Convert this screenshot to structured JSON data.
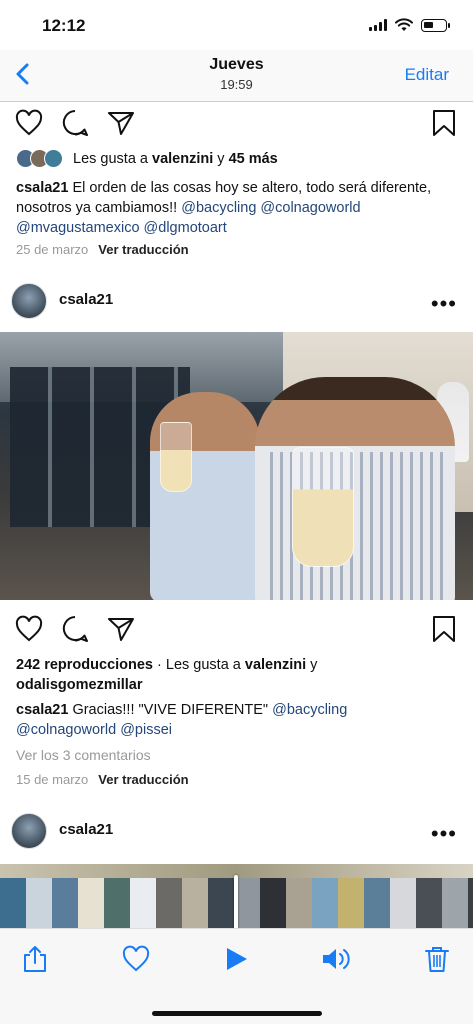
{
  "status_bar": {
    "time": "12:12"
  },
  "nav": {
    "title": "Jueves",
    "subtitle": "19:59",
    "edit_label": "Editar"
  },
  "post1": {
    "likes_prefix": "Les gusta a ",
    "likes_user": "valenzini",
    "likes_and": " y ",
    "likes_more": "45 más",
    "caption_user": "csala21",
    "caption_text": " El orden de las cosas hoy se altero, todo será diferente, nosotros ya cambiamos!! ",
    "mentions": [
      "@bacycling",
      "@colnagoworld",
      "@mvagustamexico",
      "@dlgmotoart"
    ],
    "date": "25 de marzo",
    "translate": "Ver traducción"
  },
  "post2": {
    "username": "csala21",
    "more": "•••",
    "views": "242 reproducciones",
    "likes_sep": " · Les gusta a ",
    "likes_user1": "valenzini",
    "likes_and": " y",
    "likes_user2": "odalisgomezmillar",
    "caption_user": "csala21",
    "caption_text": " Gracias!!! \"VIVE DIFERENTE\" ",
    "mentions": [
      "@bacycling",
      "@colnagoworld",
      "@pissei"
    ],
    "comments": "Ver los 3 comentarios",
    "date": "15 de marzo",
    "translate": "Ver traducción"
  },
  "post3": {
    "username": "csala21",
    "more": "•••"
  },
  "icons": [
    "heart-icon",
    "comment-icon",
    "send-icon",
    "bookmark-icon",
    "share-icon",
    "favorite-icon",
    "play-icon",
    "volume-icon",
    "trash-icon"
  ],
  "colors": {
    "accent": "#1a7cf5",
    "mention": "#24477a",
    "muted": "#999999"
  }
}
